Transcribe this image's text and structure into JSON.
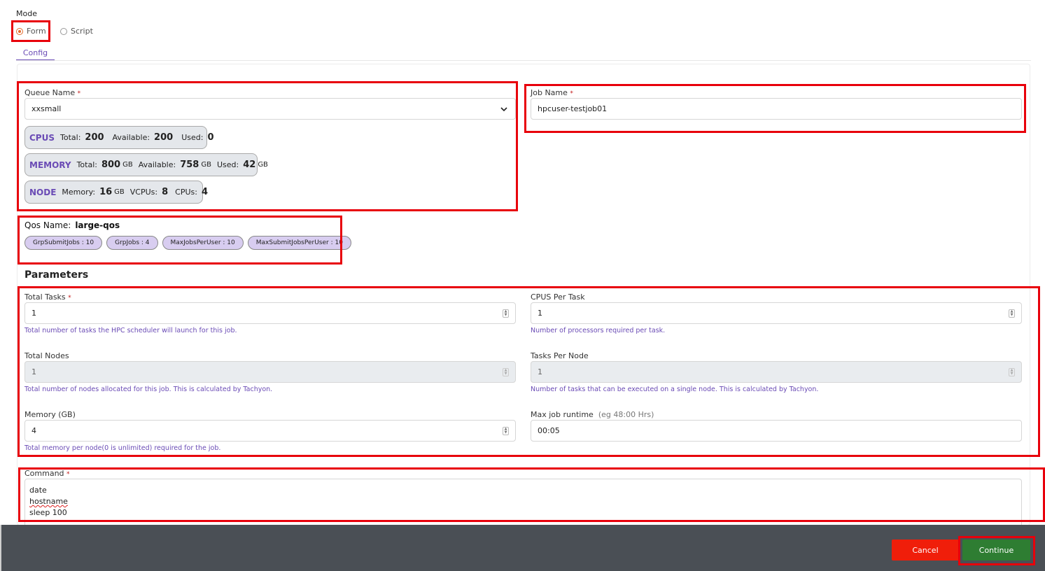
{
  "mode": {
    "label": "Mode",
    "options": [
      {
        "label": "Form",
        "selected": true
      },
      {
        "label": "Script",
        "selected": false
      }
    ]
  },
  "tabs": [
    {
      "label": "Config",
      "active": true
    }
  ],
  "queue": {
    "label": "Queue Name",
    "required_mark": "*",
    "value": "xxsmall",
    "cpus": {
      "title": "CPUS",
      "total_label": "Total:",
      "total": "200",
      "available_label": "Available:",
      "available": "200",
      "used_label": "Used:",
      "used": "0"
    },
    "memory": {
      "title": "MEMORY",
      "total_label": "Total:",
      "total": "800",
      "total_unit": "GB",
      "available_label": "Available:",
      "available": "758",
      "available_unit": "GB",
      "used_label": "Used:",
      "used": "42",
      "used_unit": "GB"
    },
    "node": {
      "title": "NODE",
      "memory_label": "Memory:",
      "memory": "16",
      "memory_unit": "GB",
      "vcpus_label": "VCPUs:",
      "vcpus": "8",
      "cpus_label": "CPUs:",
      "cpus": "4"
    }
  },
  "job_name": {
    "label": "Job Name",
    "required_mark": "*",
    "value": "hpcuser-testjob01"
  },
  "qos": {
    "label": "Qos Name:",
    "value": "large-qos",
    "tags": [
      "GrpSubmitJobs : 10",
      "GrpJobs : 4",
      "MaxJobsPerUser : 10",
      "MaxSubmitJobsPerUser : 10"
    ]
  },
  "parameters": {
    "title": "Parameters",
    "total_tasks": {
      "label": "Total Tasks",
      "required_mark": "*",
      "value": "1",
      "help": "Total number of tasks the HPC scheduler will launch for this job."
    },
    "cpus_per_task": {
      "label": "CPUS Per Task",
      "value": "1",
      "help": "Number of processors required per task."
    },
    "total_nodes": {
      "label": "Total Nodes",
      "value": "1",
      "help": "Total number of nodes allocated for this job. This is calculated by Tachyon."
    },
    "tasks_per_node": {
      "label": "Tasks Per Node",
      "value": "1",
      "help": "Number of tasks that can be executed on a single node. This is calculated by Tachyon."
    },
    "memory": {
      "label": "Memory (GB)",
      "value": "4",
      "help": "Total memory per node(0 is unlimited) required for the job."
    },
    "max_runtime": {
      "label": "Max job runtime",
      "hint": "(eg 48:00 Hrs)",
      "value": "00:05"
    }
  },
  "command": {
    "label": "Command",
    "required_mark": "*",
    "lines": [
      "date",
      "hostname",
      "sleep 100"
    ]
  },
  "footer": {
    "cancel_label": "Cancel",
    "continue_label": "Continue"
  },
  "colors": {
    "accent": "#6a4bb5",
    "highlight": "#e8000b",
    "cancel": "#f01e0a",
    "continue": "#2e7d32",
    "footer": "#4a4f55"
  }
}
